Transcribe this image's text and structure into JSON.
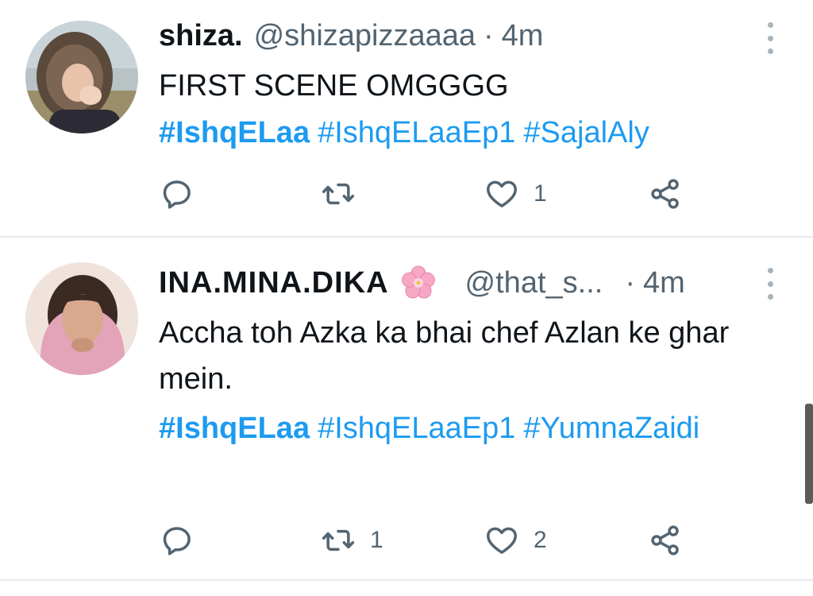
{
  "tweets": [
    {
      "display_name": "shiza.",
      "handle": "@shizapizzaaaa",
      "separator": "·",
      "time": "4m",
      "text": "FIRST SCENE OMGGGG",
      "hashtags": [
        "#IshqELaa",
        "#IshqELaaEp1",
        "#SajalAly"
      ],
      "reply_count": "",
      "retweet_count": "",
      "like_count": "1"
    },
    {
      "display_name": "INA.MINA.DIKA",
      "name_emoji": "cherry-blossom-icon",
      "handle": "@that_s...",
      "separator": "·",
      "time": "4m",
      "text": "Accha toh Azka ka bhai chef Azlan ke ghar mein.",
      "hashtags": [
        "#IshqELaa",
        "#IshqELaaEp1",
        "#YumnaZaidi"
      ],
      "reply_count": "",
      "retweet_count": "1",
      "like_count": "2"
    }
  ],
  "icons": {
    "reply": "reply-icon",
    "retweet": "retweet-icon",
    "like": "heart-icon",
    "share": "share-icon",
    "more": "more-vertical-icon"
  },
  "colors": {
    "hashtag": "#1d9bf0",
    "secondary_text": "#536471",
    "divider": "#e7e9ea"
  }
}
